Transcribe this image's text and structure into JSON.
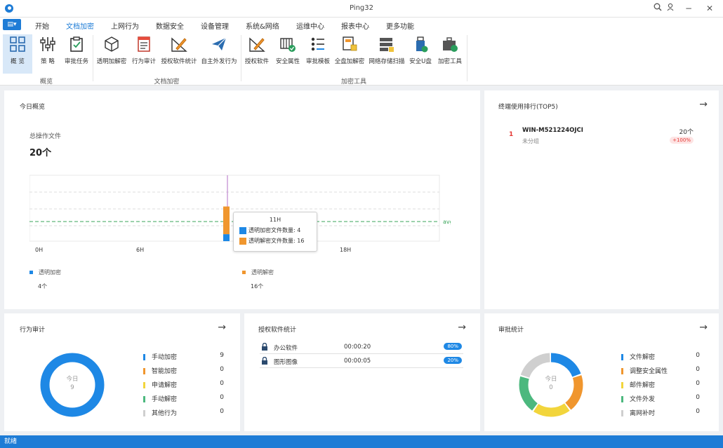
{
  "window": {
    "title": "Ping32"
  },
  "menu": {
    "tabs": [
      "开始",
      "文档加密",
      "上网行为",
      "数据安全",
      "设备管理",
      "系统&网络",
      "运维中心",
      "报表中心",
      "更多功能"
    ]
  },
  "ribbon": {
    "buttons": [
      "概 览",
      "策 略",
      "审批任务",
      "透明加解密",
      "行为审计",
      "授权软件统计",
      "自主外发行为",
      "授权软件",
      "安全属性",
      "审批模板",
      "全盘加解密",
      "网络存储扫描",
      "安全U盘",
      "加密工具"
    ],
    "groups": [
      "概览",
      "文档加密",
      "加密工具"
    ]
  },
  "overview": {
    "title": "今日概览",
    "total_label": "总操作文件",
    "total_value": "20个",
    "x_ticks": [
      "0H",
      "6H",
      "18H"
    ],
    "avg_label": "avg",
    "tooltip": {
      "title": "11H",
      "rows": [
        "透明加密文件数量: 4",
        "透明解密文件数量: 16"
      ]
    },
    "legend": [
      {
        "name": "透明加密",
        "value": "4个",
        "color": "#1e88e5"
      },
      {
        "name": "透明解密",
        "value": "16个",
        "color": "#f0962e"
      }
    ]
  },
  "chart_data": {
    "type": "bar",
    "stacked": true,
    "categories": [
      "11H"
    ],
    "series": [
      {
        "name": "透明加密",
        "values": [
          4
        ]
      },
      {
        "name": "透明解密",
        "values": [
          16
        ]
      }
    ],
    "x_ticks": [
      "0H",
      "6H",
      "18H"
    ],
    "avg_line": true
  },
  "ranking": {
    "title": "终端使用排行(TOP5)",
    "items": [
      {
        "rank": "1",
        "name": "WIN-M521224OJCI",
        "group": "未分组",
        "count": "20个",
        "change": "+100%"
      }
    ]
  },
  "audit": {
    "title": "行为审计",
    "center_label": "今日",
    "center_value": "9",
    "legend": [
      {
        "name": "手动加密",
        "value": "9",
        "color": "#1e88e5"
      },
      {
        "name": "智能加密",
        "value": "0",
        "color": "#f0962e"
      },
      {
        "name": "申请解密",
        "value": "0",
        "color": "#f2d53c"
      },
      {
        "name": "手动解密",
        "value": "0",
        "color": "#4cb87e"
      },
      {
        "name": "其他行为",
        "value": "0",
        "color": "#cfcfcf"
      }
    ]
  },
  "software": {
    "title": "授权软件统计",
    "rows": [
      {
        "name": "办公软件",
        "time": "00:00:20",
        "pct": "80%"
      },
      {
        "name": "图形图像",
        "time": "00:00:05",
        "pct": "20%"
      }
    ]
  },
  "approval": {
    "title": "审批统计",
    "center_label": "今日",
    "center_value": "0",
    "legend": [
      {
        "name": "文件解密",
        "value": "0",
        "color": "#1e88e5"
      },
      {
        "name": "调整安全属性",
        "value": "0",
        "color": "#f0962e"
      },
      {
        "name": "邮件解密",
        "value": "0",
        "color": "#f2d53c"
      },
      {
        "name": "文件外发",
        "value": "0",
        "color": "#4cb87e"
      },
      {
        "name": "离网补时",
        "value": "0",
        "color": "#cfcfcf"
      }
    ]
  },
  "status": {
    "text": "就绪"
  }
}
